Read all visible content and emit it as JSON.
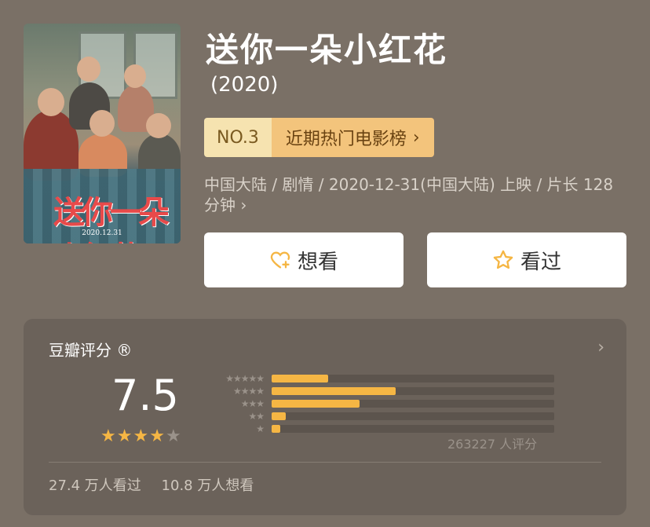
{
  "movie": {
    "title": "送你一朵小红花",
    "year": "(2020)",
    "poster_date": "2020.12.31",
    "poster_title_art": "送你一朵小红花"
  },
  "rank": {
    "no": "NO.3",
    "list": "近期热门电影榜",
    "chevron": "›"
  },
  "meta": {
    "line": "中国大陆 / 剧情 / 2020-12-31(中国大陆) 上映 / 片长 128 分钟 ›"
  },
  "actions": {
    "want": "想看",
    "seen": "看过"
  },
  "rating": {
    "title": "豆瓣评分 ®",
    "chevron": "›",
    "score": "7.5",
    "stars_value": 4,
    "stars_max": 5,
    "distribution": [
      {
        "stars": "★★★★★",
        "fraction": 0.2
      },
      {
        "stars": "★★★★",
        "fraction": 0.44
      },
      {
        "stars": "★★★",
        "fraction": 0.31
      },
      {
        "stars": "★★",
        "fraction": 0.05
      },
      {
        "stars": "★",
        "fraction": 0.03
      }
    ],
    "count": "263227 人评分",
    "seen_count": "27.4 万人看过",
    "want_count": "10.8 万人想看"
  },
  "colors": {
    "accent": "#f5b644",
    "background": "#7a7066",
    "card": "#6b625a"
  }
}
